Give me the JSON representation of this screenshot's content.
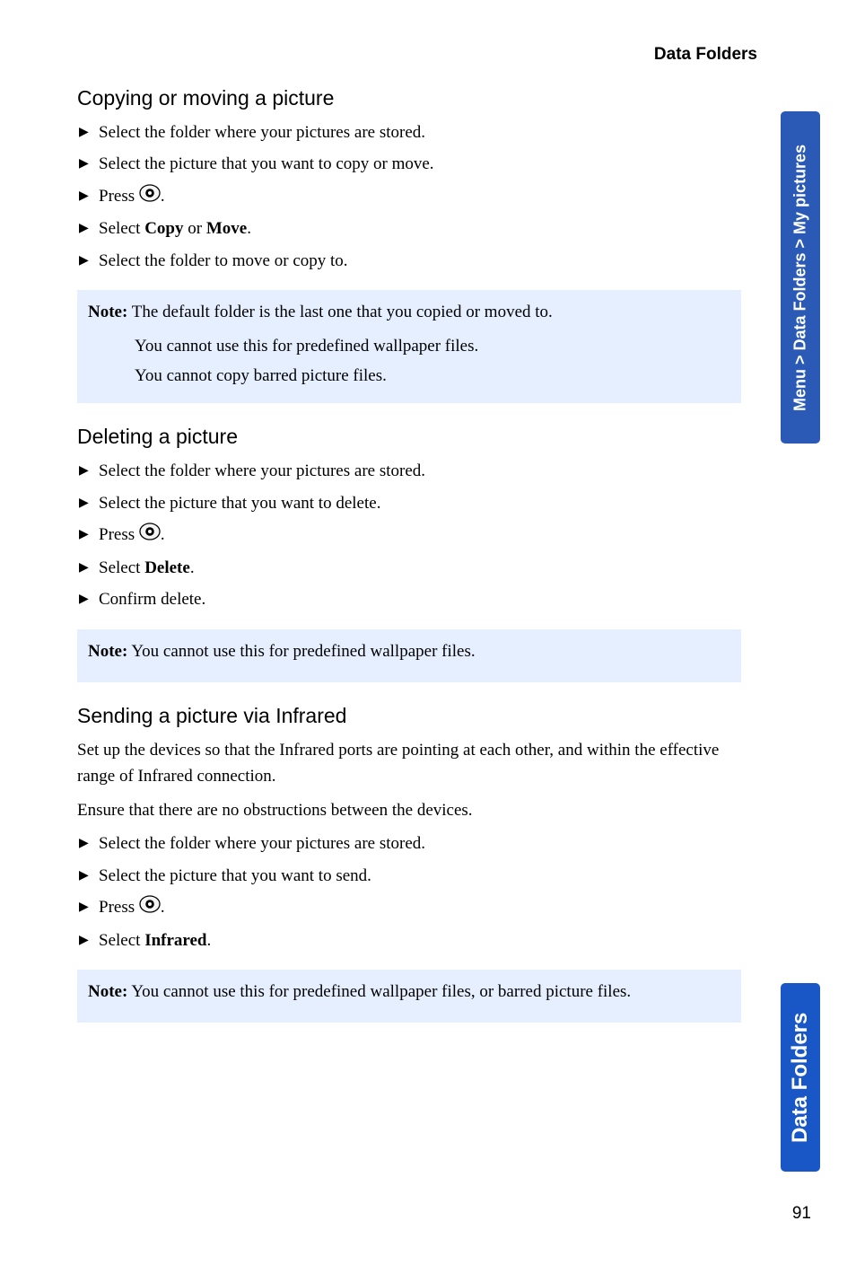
{
  "header": {
    "title": "Data Folders"
  },
  "sidebar": {
    "breadcrumb": "Menu > Data Folders > My pictures",
    "section": "Data Folders"
  },
  "page_number": "91",
  "sec1": {
    "title": "Copying or moving a picture",
    "steps": {
      "s1": "Select the folder where your pictures are stored.",
      "s2": "Select the picture that you want to copy or move.",
      "s3a": "Press ",
      "s3b": ".",
      "s4a": "Select ",
      "s4b": "Copy",
      "s4c": " or ",
      "s4d": "Move",
      "s4e": ".",
      "s5": "Select the folder to move or copy to."
    },
    "note": {
      "label": "Note:",
      "l1": " The default folder is the last one that you copied or moved to.",
      "l2": "You cannot use this for predefined wallpaper files.",
      "l3": "You cannot copy barred picture files."
    }
  },
  "sec2": {
    "title": "Deleting a picture",
    "steps": {
      "s1": "Select the folder where your pictures are stored.",
      "s2": "Select the picture that you want to delete.",
      "s3a": "Press ",
      "s3b": ".",
      "s4a": "Select ",
      "s4b": "Delete",
      "s4c": ".",
      "s5": "Confirm delete."
    },
    "note": {
      "label": "Note:",
      "l1": " You cannot use this for predefined wallpaper files."
    }
  },
  "sec3": {
    "title": "Sending a picture via Infrared",
    "p1": "Set up the devices so that the Infrared ports are pointing at each other, and within the effective range of Infrared connection.",
    "p2": "Ensure that there are no obstructions between the devices.",
    "steps": {
      "s1": "Select the folder where your pictures are stored.",
      "s2": "Select the picture that you want to send.",
      "s3a": "Press ",
      "s3b": ".",
      "s4a": "Select ",
      "s4b": "Infrared",
      "s4c": "."
    },
    "note": {
      "label": "Note:",
      "l1": " You cannot use this for predefined wallpaper files, or barred picture files."
    }
  }
}
